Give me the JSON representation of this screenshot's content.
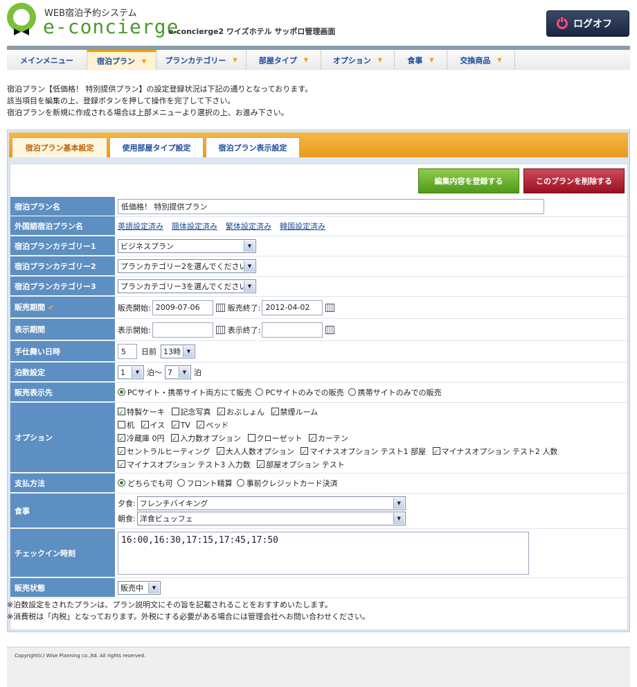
{
  "header": {
    "logo_sub": "WEB宿泊予約システム",
    "logo_main": "e-concierge",
    "system_title": "e-concierge2 ワイズホテル サッポロ管理画面",
    "logoff_label": "ログオフ"
  },
  "nav": {
    "items": [
      {
        "label": "メインメニュー"
      },
      {
        "label": "宿泊プラン"
      },
      {
        "label": "プランカテゴリー"
      },
      {
        "label": "部屋タイプ"
      },
      {
        "label": "オプション"
      },
      {
        "label": "食事"
      },
      {
        "label": "交換商品"
      }
    ]
  },
  "intro": {
    "line1": "宿泊プラン【低価格！ 特別提供プラン】の設定登録状況は下記の通りとなっております。",
    "line2": "該当項目を編集の上、登録ボタンを押して操作を完了して下さい。",
    "line3": "宿泊プランを新規に作成される場合は上部メニューより選択の上、お進み下さい。"
  },
  "tabs": [
    {
      "label": "宿泊プラン基本設定"
    },
    {
      "label": "使用部屋タイプ設定"
    },
    {
      "label": "宿泊プラン表示設定"
    }
  ],
  "buttons": {
    "save": "編集内容を登録する",
    "delete": "このプランを削除する"
  },
  "form": {
    "plan_name": {
      "label": "宿泊プラン名",
      "value": "低価格！ 特別提供プラン"
    },
    "foreign": {
      "label": "外国語宿泊プラン名",
      "links": [
        "英語設定済み",
        "簡体設定済み",
        "繁体設定済み",
        "韓国設定済み"
      ]
    },
    "cat1": {
      "label": "宿泊プランカテゴリー1",
      "value": "ビジネスプラン"
    },
    "cat2": {
      "label": "宿泊プランカテゴリー2",
      "value": "プランカテゴリー2を選んでください"
    },
    "cat3": {
      "label": "宿泊プランカテゴリー3",
      "value": "プランカテゴリー3を選んでください"
    },
    "sale_period": {
      "label": "販売期間",
      "start_label": "販売開始:",
      "start": "2009-07-06",
      "end_label": "販売終了:",
      "end": "2012-04-02"
    },
    "display_period": {
      "label": "表示期間",
      "start_label": "表示開始:",
      "start": "",
      "end_label": "表示終了:",
      "end": ""
    },
    "closing": {
      "label": "手仕舞い日時",
      "days": "5",
      "days_unit": "日前",
      "hour": "13時"
    },
    "nights": {
      "label": "泊数設定",
      "min": "1",
      "sep": "泊～",
      "max": "7",
      "unit": "泊"
    },
    "sales_dest": {
      "label": "販売表示先",
      "options": [
        "PCサイト・携帯サイト両方にて販売",
        "PCサイトのみでの販売",
        "携帯サイトのみでの販売"
      ],
      "selected": 0
    },
    "options": {
      "label": "オプション",
      "rows": [
        [
          {
            "name": "特製ケーキ",
            "on": true
          },
          {
            "name": "記念写真",
            "on": false
          },
          {
            "name": "おぶしょん",
            "on": true
          },
          {
            "name": "禁煙ルーム",
            "on": true
          }
        ],
        [
          {
            "name": "机",
            "on": false
          },
          {
            "name": "イス",
            "on": true
          },
          {
            "name": "TV",
            "on": true
          },
          {
            "name": "ベッド",
            "on": true
          }
        ],
        [
          {
            "name": "冷蔵庫 0円",
            "on": true
          },
          {
            "name": "入力数オプション",
            "on": true
          },
          {
            "name": "クローゼット",
            "on": false
          },
          {
            "name": "カーテン",
            "on": true
          }
        ],
        [
          {
            "name": "セントラルヒーティング",
            "on": true
          },
          {
            "name": "大人人数オプション",
            "on": true
          },
          {
            "name": "マイナスオプション テスト1 部屋",
            "on": true
          },
          {
            "name": "マイナスオプション テスト2 人数",
            "on": true
          }
        ],
        [
          {
            "name": "マイナスオプション テスト3 入力数",
            "on": true
          },
          {
            "name": "部屋オプション テスト",
            "on": true
          }
        ]
      ]
    },
    "payment": {
      "label": "支払方法",
      "options": [
        "どちらでも可",
        "フロント精算",
        "事前クレジットカード決済"
      ],
      "selected": 0
    },
    "meal": {
      "label": "食事",
      "dinner_label": "夕食:",
      "dinner": "フレンチバイキング",
      "breakfast_label": "朝食:",
      "breakfast": "洋食ビュッフェ"
    },
    "checkin": {
      "label": "チェックイン時刻",
      "value": "16:00,16:30,17:15,17:45,17:50"
    },
    "status": {
      "label": "販売状態",
      "value": "販売中"
    }
  },
  "notes": {
    "line1": "※泊数設定をされたプランは、プラン説明文にその旨を記載されることをおすすめいたします。",
    "line2": "※消費税は「内税」となっております。外税にする必要がある場合には管理会社へお問い合わせください。"
  },
  "footer": {
    "copyright": "Copyright(c) Wise Planning co.,ltd. All rights reserved."
  }
}
